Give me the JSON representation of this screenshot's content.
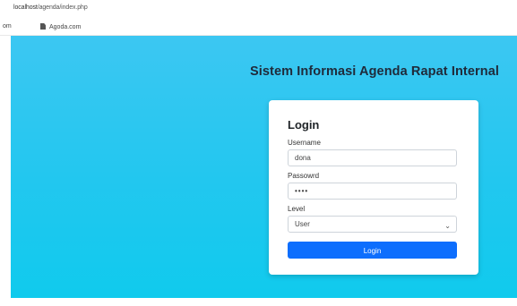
{
  "browser": {
    "url_host": "localhost",
    "url_path": "/agenda/index.php"
  },
  "bookmarks": [
    {
      "label": "om"
    },
    {
      "label": "Agoda.com"
    }
  ],
  "page": {
    "title": "Sistem Informasi Agenda Rapat Internal"
  },
  "login_form": {
    "heading": "Login",
    "username_label": "Username",
    "username_value": "dona",
    "password_label": "Passowrd",
    "password_mask": "••••",
    "level_label": "Level",
    "level_value": "User",
    "submit_label": "Login"
  },
  "colors": {
    "hero_bg": "#22c7ef",
    "primary_button": "#0d6efd",
    "title_text": "#1f2a3a"
  },
  "icons": {
    "select_chevron": "chevron-down-icon",
    "bookmark": "file-icon"
  }
}
